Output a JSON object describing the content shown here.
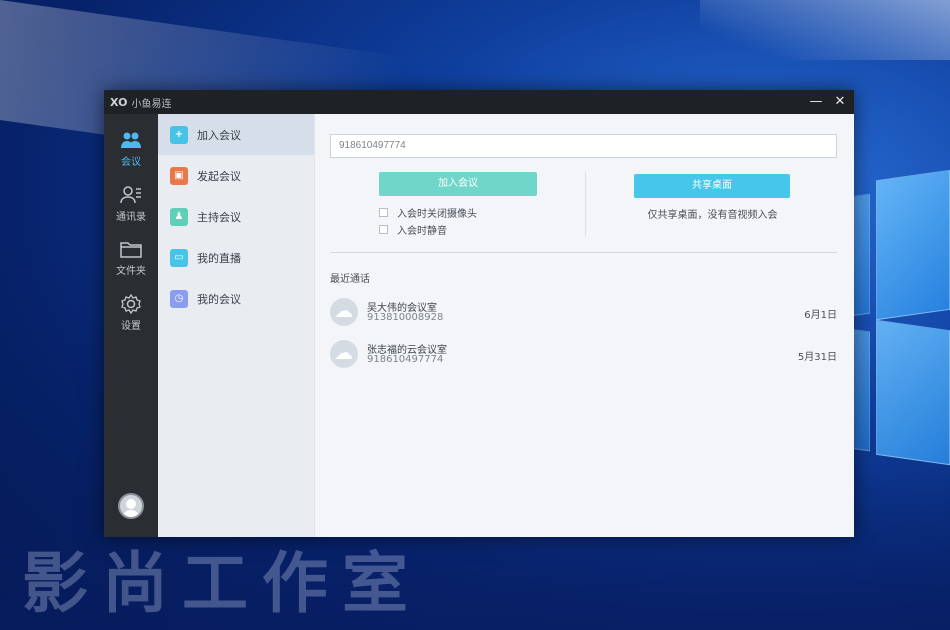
{
  "app": {
    "title": "小鱼易连",
    "logo_glyph": "XO",
    "minimize_glyph": "—",
    "close_glyph": "✕"
  },
  "rail": {
    "items": [
      {
        "label": "会议",
        "icon": "people-icon",
        "active": true
      },
      {
        "label": "通讯录",
        "icon": "contacts-icon",
        "active": false
      },
      {
        "label": "文件夹",
        "icon": "folder-icon",
        "active": false
      },
      {
        "label": "设置",
        "icon": "gear-icon",
        "active": false
      }
    ],
    "accent": "#4fb8ef"
  },
  "submenu": {
    "items": [
      {
        "label": "加入会议",
        "icon": "plus-circle-icon",
        "color": "#48c3e8",
        "active": true
      },
      {
        "label": "发起会议",
        "icon": "start-meeting-icon",
        "color": "#e8784a",
        "active": false
      },
      {
        "label": "主持会议",
        "icon": "host-icon",
        "color": "#5fcfb8",
        "active": false
      },
      {
        "label": "我的直播",
        "icon": "live-icon",
        "color": "#48c3e8",
        "active": false
      },
      {
        "label": "我的会议",
        "icon": "clock-icon",
        "color": "#8a9df0",
        "active": false
      }
    ]
  },
  "join": {
    "input_value": "918610497774",
    "join_button": "加入会议",
    "join_color": "#6fd6c9",
    "option_camera_off": "入会时关闭摄像头",
    "option_mute": "入会时静音",
    "share_button": "共享桌面",
    "share_color": "#44c7ea",
    "share_note": "仅共享桌面，没有音视频入会"
  },
  "recent": {
    "label": "最近通话",
    "calls": [
      {
        "name": "吴大伟的会议室",
        "number": "913810008928",
        "date": "6月1日"
      },
      {
        "name": "张志福的云会议室",
        "number": "918610497774",
        "date": "5月31日"
      }
    ]
  },
  "watermark": "影尚工作室"
}
